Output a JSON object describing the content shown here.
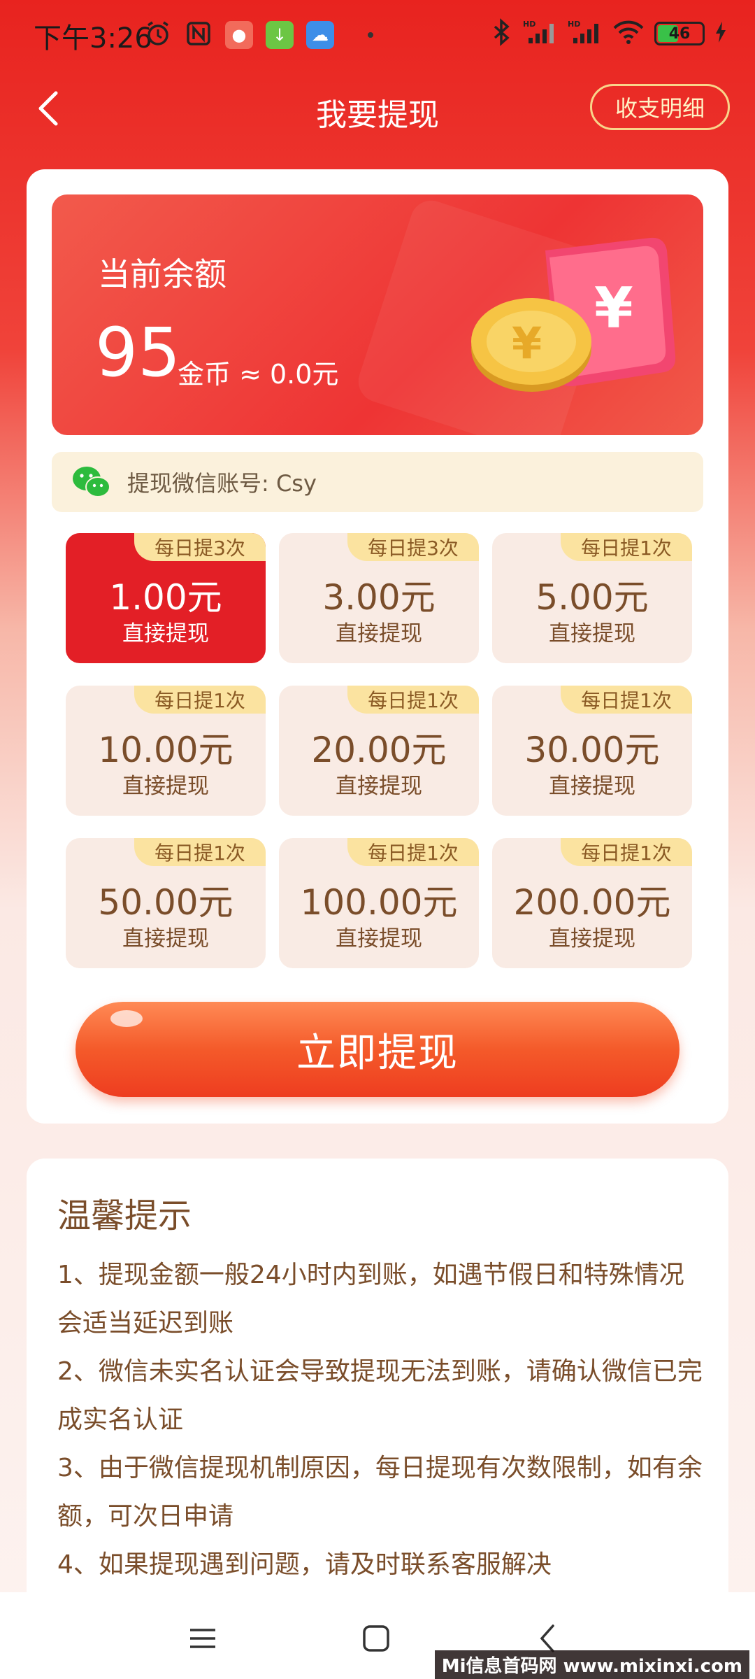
{
  "status_bar": {
    "time": "下午3:26",
    "battery": "46"
  },
  "header": {
    "title": "我要提现",
    "detail_button": "收支明细"
  },
  "balance": {
    "label": "当前余额",
    "amount": "95",
    "unit_text": "金币 ≈ 0.0元"
  },
  "wechat": {
    "account_text": "提现微信账号: Csy"
  },
  "options": [
    {
      "tag": "每日提3次",
      "amount": "1.00元",
      "sub": "直接提现",
      "selected": true
    },
    {
      "tag": "每日提3次",
      "amount": "3.00元",
      "sub": "直接提现",
      "selected": false
    },
    {
      "tag": "每日提1次",
      "amount": "5.00元",
      "sub": "直接提现",
      "selected": false
    },
    {
      "tag": "每日提1次",
      "amount": "10.00元",
      "sub": "直接提现",
      "selected": false
    },
    {
      "tag": "每日提1次",
      "amount": "20.00元",
      "sub": "直接提现",
      "selected": false
    },
    {
      "tag": "每日提1次",
      "amount": "30.00元",
      "sub": "直接提现",
      "selected": false
    },
    {
      "tag": "每日提1次",
      "amount": "50.00元",
      "sub": "直接提现",
      "selected": false
    },
    {
      "tag": "每日提1次",
      "amount": "100.00元",
      "sub": "直接提现",
      "selected": false
    },
    {
      "tag": "每日提1次",
      "amount": "200.00元",
      "sub": "直接提现",
      "selected": false
    }
  ],
  "withdraw_button": "立即提现",
  "tips": {
    "title": "温馨提示",
    "items": [
      "1、提现金额一般24小时内到账，如遇节假日和特殊情况会适当延迟到账",
      "2、微信未实名认证会导致提现无法到账，请确认微信已完成实名认证",
      "3、由于微信提现机制原因，每日提现有次数限制，如有余额，可次日申请",
      "4、如果提现遇到问题，请及时联系客服解决"
    ]
  },
  "watermark": "Mi信息首码网 www.mixinxi.com",
  "colors": {
    "brand_red": "#e31f26",
    "text_brown": "#7a4d2a",
    "tag_yellow": "#fbe3a0"
  }
}
